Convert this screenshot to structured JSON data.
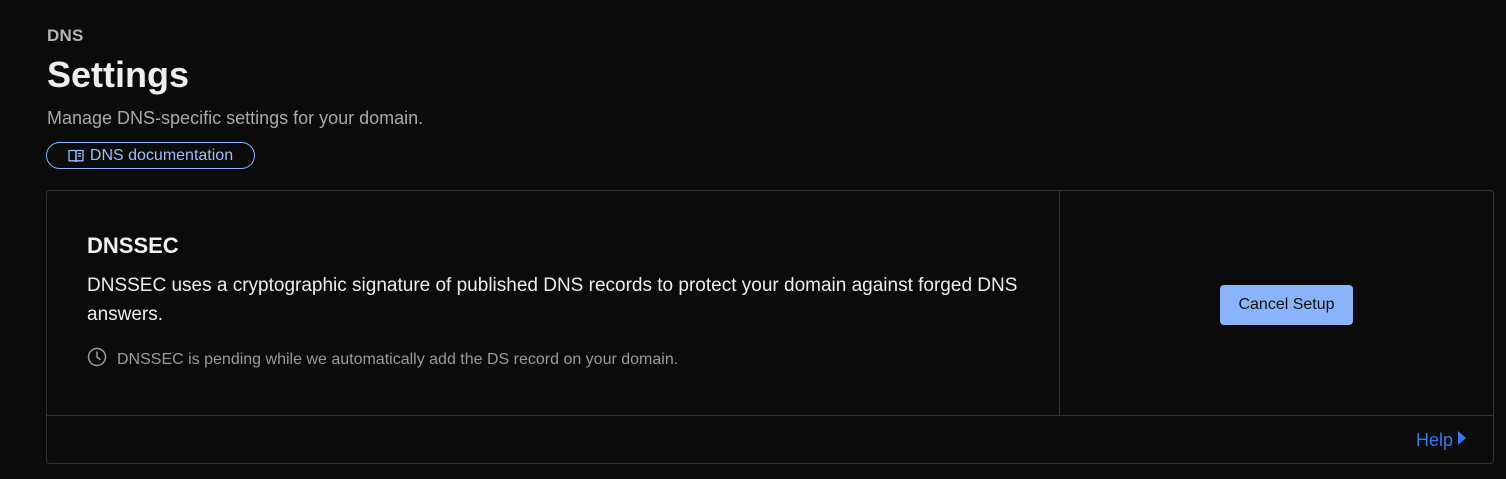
{
  "header": {
    "section": "DNS",
    "title": "Settings",
    "subtitle": "Manage DNS-specific settings for your domain.",
    "doc_link_label": "DNS documentation"
  },
  "dnssec_card": {
    "title": "DNSSEC",
    "description": "DNSSEC uses a cryptographic signature of published DNS records to protect your domain against forged DNS answers.",
    "status_text": "DNSSEC is pending while we automatically add the DS record on your domain.",
    "cancel_button_label": "Cancel Setup",
    "help_label": "Help"
  },
  "icons": {
    "doc_link": "book-icon",
    "status": "clock-icon",
    "help": "caret-right-icon"
  },
  "colors": {
    "background": "#0b0b0b",
    "accent_link": "#9dbcff",
    "button": "#8ab4fa",
    "help_link": "#2f7bf5"
  }
}
